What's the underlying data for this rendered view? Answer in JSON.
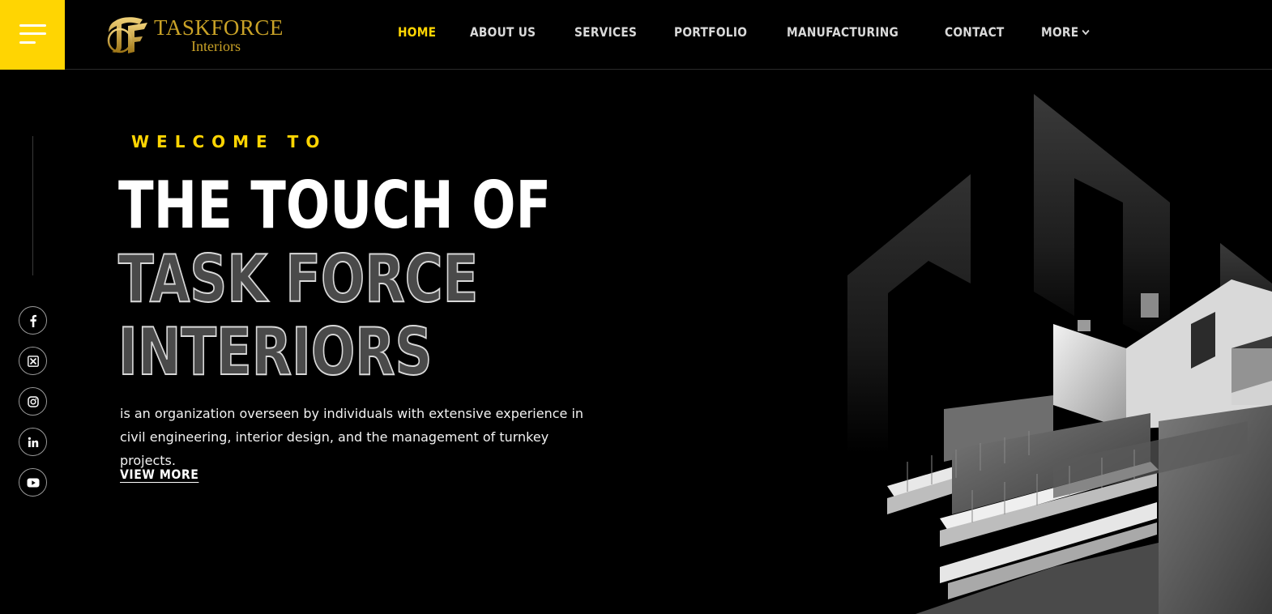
{
  "header": {
    "menu_icon": "hamburger-icon",
    "logo": {
      "brand": "TASKFORCE",
      "sub": "Interiors",
      "mark": "TF"
    },
    "nav": [
      {
        "label": "HOME",
        "active": true
      },
      {
        "label": "ABOUT US",
        "active": false
      },
      {
        "label": "SERVICES",
        "active": false
      },
      {
        "label": "PORTFOLIO",
        "active": false
      },
      {
        "label": "MANUFACTURING",
        "active": false
      },
      {
        "label": "CONTACT",
        "active": false
      },
      {
        "label": "MORE",
        "active": false,
        "icon": "chevron-down-icon"
      }
    ]
  },
  "social": [
    {
      "name": "facebook",
      "icon": "facebook-icon"
    },
    {
      "name": "x",
      "icon": "x-icon"
    },
    {
      "name": "instagram",
      "icon": "instagram-icon"
    },
    {
      "name": "linkedin",
      "icon": "linkedin-icon"
    },
    {
      "name": "youtube",
      "icon": "youtube-icon"
    }
  ],
  "hero": {
    "eyebrow": "WELCOME TO",
    "title_line1": "THE TOUCH OF",
    "title_line2": "TASK FORCE",
    "title_line3": "INTERIORS",
    "description": "is an organization overseen by individuals with extensive experience in civil engineering, interior design, and the management of turnkey projects.",
    "cta": "VIEW MORE"
  },
  "colors": {
    "accent": "#ffd502",
    "background": "#000000",
    "logo_gold": "#c9a227"
  }
}
